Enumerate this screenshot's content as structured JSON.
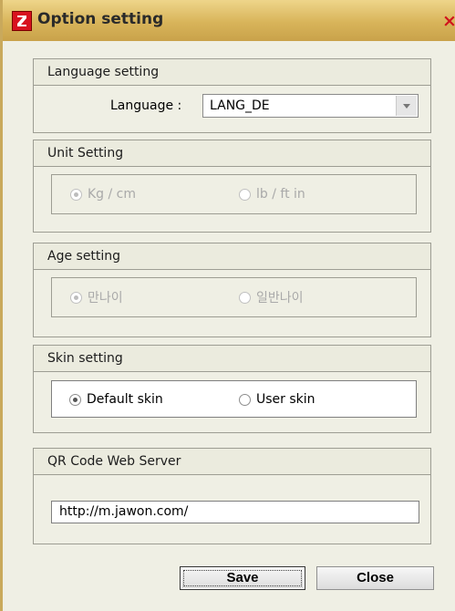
{
  "window": {
    "title": "Option setting",
    "close_glyph": "×",
    "icon": "app-logo-icon"
  },
  "language_section": {
    "title": "Language setting",
    "label": "Language :",
    "selected": "LANG_DE"
  },
  "unit_section": {
    "title": "Unit Setting",
    "options": [
      "Kg / cm",
      "lb / ft in"
    ],
    "selected_index": 0
  },
  "age_section": {
    "title": "Age setting",
    "options": [
      "만나이",
      "일반나이"
    ],
    "selected_index": 0
  },
  "skin_section": {
    "title": "Skin setting",
    "options": [
      "Default skin",
      "User skin"
    ],
    "selected_index": 0
  },
  "qr_section": {
    "title": "QR Code Web Server",
    "url": "http://m.jawon.com/"
  },
  "buttons": {
    "save": "Save",
    "close": "Close"
  }
}
